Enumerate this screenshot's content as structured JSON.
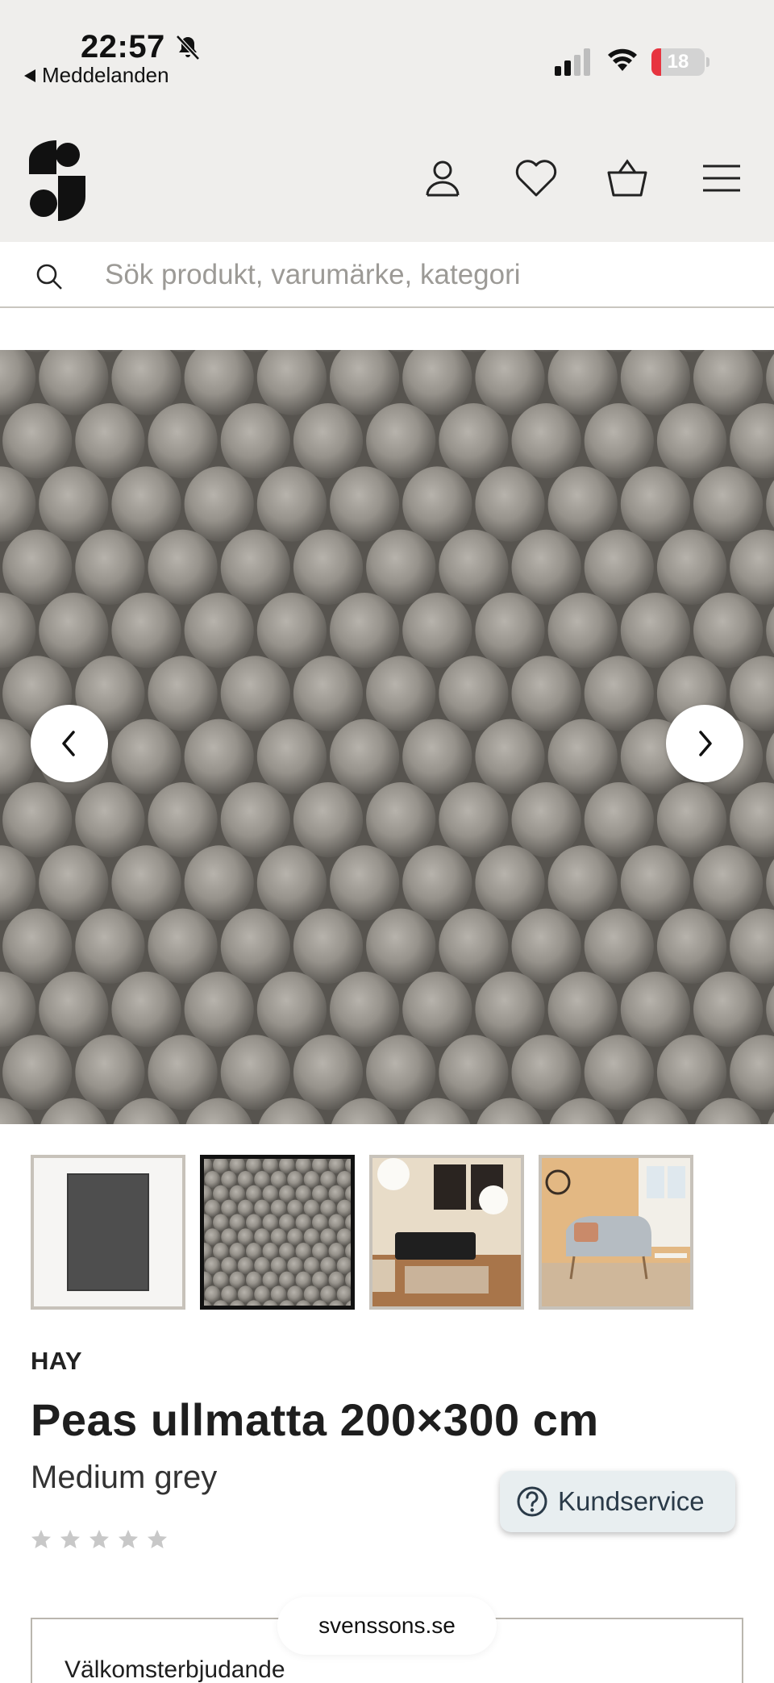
{
  "status_bar": {
    "time": "22:57",
    "back_app": "Meddelanden",
    "battery_level": "18",
    "battery_fraction": 0.18
  },
  "header": {
    "icons": [
      "account-icon",
      "heart-icon",
      "basket-icon",
      "menu-icon"
    ]
  },
  "search": {
    "placeholder": "Sök produkt, varumärke, kategori",
    "value": ""
  },
  "gallery": {
    "thumbnails": [
      "rug-overview",
      "wool-closeup",
      "living-room-sofa",
      "living-room-armchair"
    ],
    "active_thumbnail": 1
  },
  "product": {
    "brand": "HAY",
    "title": "Peas ullmatta 200×300 cm",
    "variant": "Medium grey",
    "rating_stars": 5,
    "star_color": "#c8c8c8"
  },
  "support": {
    "label": "Kundservice"
  },
  "offer": {
    "title": "Välkomsterbjudande"
  },
  "browser": {
    "url": "svenssons.se"
  },
  "colors": {
    "header_bg": "#efeeec",
    "accent_dark": "#111111"
  }
}
